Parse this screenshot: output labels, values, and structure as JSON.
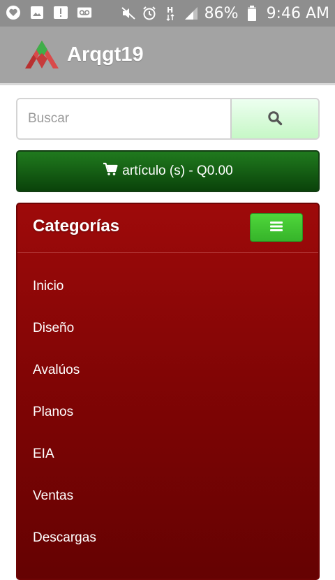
{
  "status_bar": {
    "battery": "86%",
    "time": "9:46 AM",
    "network_type": "H",
    "left_icons": [
      "notification-icon",
      "image-icon",
      "alert-icon",
      "voicemail-icon"
    ],
    "right_icons": [
      "mute-icon",
      "alarm-icon",
      "network-type-icon",
      "signal-icon",
      "battery-icon"
    ]
  },
  "header": {
    "title": "Arqgt19",
    "logo": "arqgt19-logo"
  },
  "search": {
    "placeholder": "Buscar",
    "value": "",
    "icon": "search-icon"
  },
  "cart": {
    "label": "artículo (s) - Q0.00",
    "icon": "shopping-cart-icon"
  },
  "categories": {
    "title": "Categorías",
    "toggle_icon": "hamburger-icon",
    "items": [
      {
        "label": "Inicio"
      },
      {
        "label": "Diseño"
      },
      {
        "label": "Avalúos"
      },
      {
        "label": "Planos"
      },
      {
        "label": "EIA"
      },
      {
        "label": "Ventas"
      },
      {
        "label": "Descargas"
      }
    ]
  },
  "colors": {
    "status_bar": "#8e8e8e",
    "header": "#a3a3a3",
    "cart_green": "#0f5a0f",
    "panel_red": "#8b0606",
    "toggle_green": "#44c531",
    "search_button": "#d6fad6"
  }
}
